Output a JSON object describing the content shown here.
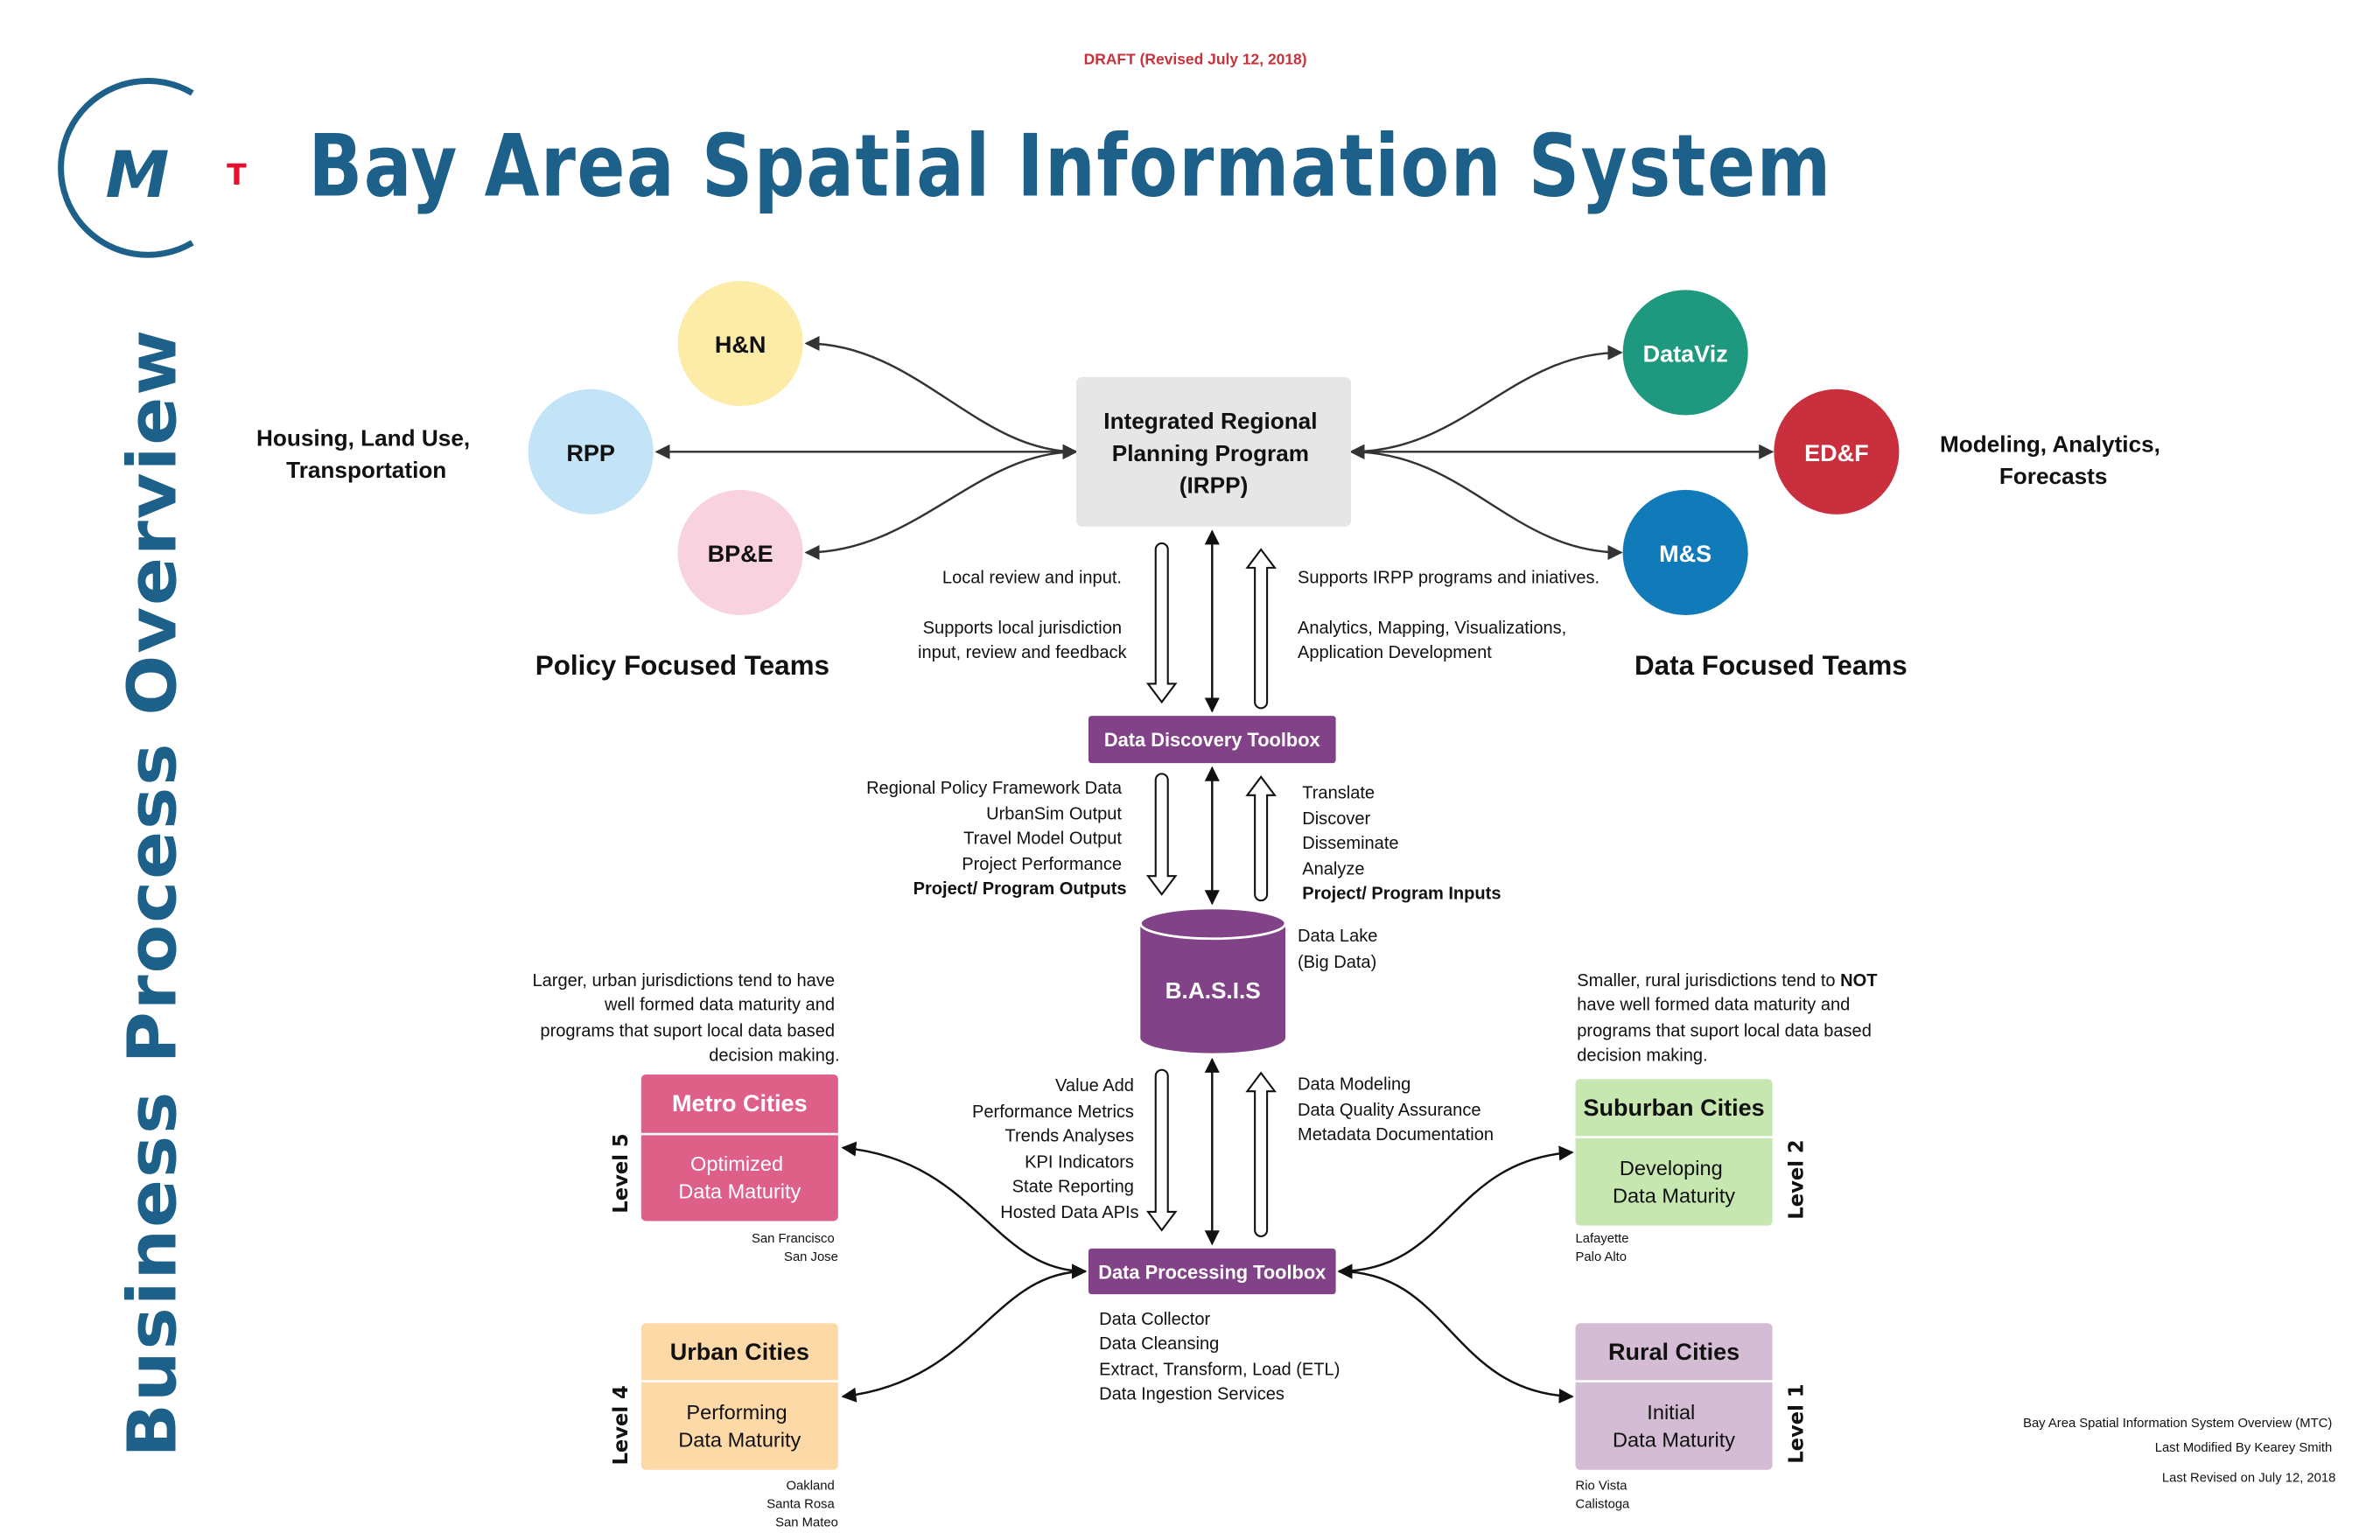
{
  "draft_notice": "DRAFT (Revised July 12, 2018)",
  "logo": {
    "letter_main": "M",
    "letter_accent": "T"
  },
  "title": "Bay Area Spatial Information System",
  "side_title": "Business Process Overview",
  "colors": {
    "brand_blue": "#1d6089",
    "draft_red": "#c8323c",
    "purple": "#824287",
    "irpp_gray": "#e6e6e6"
  },
  "policy_group": {
    "heading": "Policy Focused Teams",
    "description_lines": [
      "Housing, Land Use,",
      "Transportation"
    ],
    "teams": [
      {
        "label": "H&N",
        "color": "#fdeba8"
      },
      {
        "label": "RPP",
        "color": "#c3e4f6"
      },
      {
        "label": "BP&E",
        "color": "#f8d3df"
      }
    ]
  },
  "data_group": {
    "heading": "Data Focused Teams",
    "description_lines": [
      "Modeling, Analytics,",
      "Forecasts"
    ],
    "teams": [
      {
        "label": "DataViz",
        "color": "#1e987e"
      },
      {
        "label": "ED&F",
        "color": "#c92f3c"
      },
      {
        "label": "M&S",
        "color": "#117ab9"
      }
    ]
  },
  "irpp": {
    "lines": [
      "Integrated Regional",
      "Planning Program",
      "(IRPP)"
    ]
  },
  "irpp_links": {
    "left": [
      "Local review and input.",
      "",
      "Supports local jurisdiction",
      "input, review and feedback"
    ],
    "right": [
      "Supports IRPP programs and iniatives.",
      "",
      "Analytics, Mapping, Visualizations,",
      "Application Development"
    ]
  },
  "data_discovery_toolbox": {
    "label": "Data Discovery Toolbox"
  },
  "discovery_links": {
    "left": [
      "Regional Policy Framework Data",
      "UrbanSim Output",
      "Travel Model Output",
      "Project Performance"
    ],
    "left_bold": "Project/ Program Outputs",
    "right": [
      "Translate",
      "Discover",
      "Disseminate",
      "Analyze"
    ],
    "right_bold": "Project/ Program Inputs"
  },
  "basis": {
    "label": "B.A.S.I.S",
    "note_lines": [
      "Data Lake",
      "(Big Data)"
    ]
  },
  "processing_links": {
    "left": [
      "Value Add",
      "Performance Metrics",
      "Trends Analyses",
      "KPI Indicators",
      "State Reporting",
      "Hosted Data APIs"
    ],
    "right": [
      "Data Modeling",
      "Data Quality Assurance",
      "Metadata Documentation"
    ]
  },
  "data_processing_toolbox": {
    "label": "Data Processing Toolbox",
    "services": [
      "Data Collector",
      "Data Cleansing",
      "Extract, Transform, Load (ETL)",
      "Data Ingestion Services"
    ]
  },
  "urban_note": [
    "Larger, urban jurisdictions tend to have",
    "well formed data maturity and",
    "programs that suport local data based",
    "decision making."
  ],
  "rural_note": {
    "line1_prefix": "Smaller, rural jurisdictions tend to ",
    "line1_bold": "NOT",
    "lines": [
      "have well formed data maturity and",
      "programs that suport local data based",
      "decision making."
    ]
  },
  "city_tiers": [
    {
      "name": "Metro Cities",
      "maturity_lines": [
        "Optimized",
        "Data Maturity"
      ],
      "level": "Level 5",
      "examples": [
        "San Francisco",
        "San Jose"
      ],
      "color": "#de6088"
    },
    {
      "name": "Urban Cities",
      "maturity_lines": [
        "Performing",
        "Data Maturity"
      ],
      "level": "Level 4",
      "examples": [
        "Oakland",
        "Santa Rosa",
        "San Mateo"
      ],
      "color": "#fdd9a8"
    },
    {
      "name": "Suburban Cities",
      "maturity_lines": [
        "Developing",
        "Data Maturity"
      ],
      "level": "Level 2",
      "examples": [
        "Lafayette",
        "Palo Alto"
      ],
      "color": "#c6e7b0"
    },
    {
      "name": "Rural Cities",
      "maturity_lines": [
        "Initial",
        "Data Maturity"
      ],
      "level": "Level 1",
      "examples": [
        "Rio Vista",
        "Calistoga"
      ],
      "color": "#d3bcd4"
    }
  ],
  "footer": [
    "Bay Area Spatial Information System Overview (MTC)",
    "Last Modified By Kearey Smith",
    "Last Revised on July 12, 2018"
  ]
}
